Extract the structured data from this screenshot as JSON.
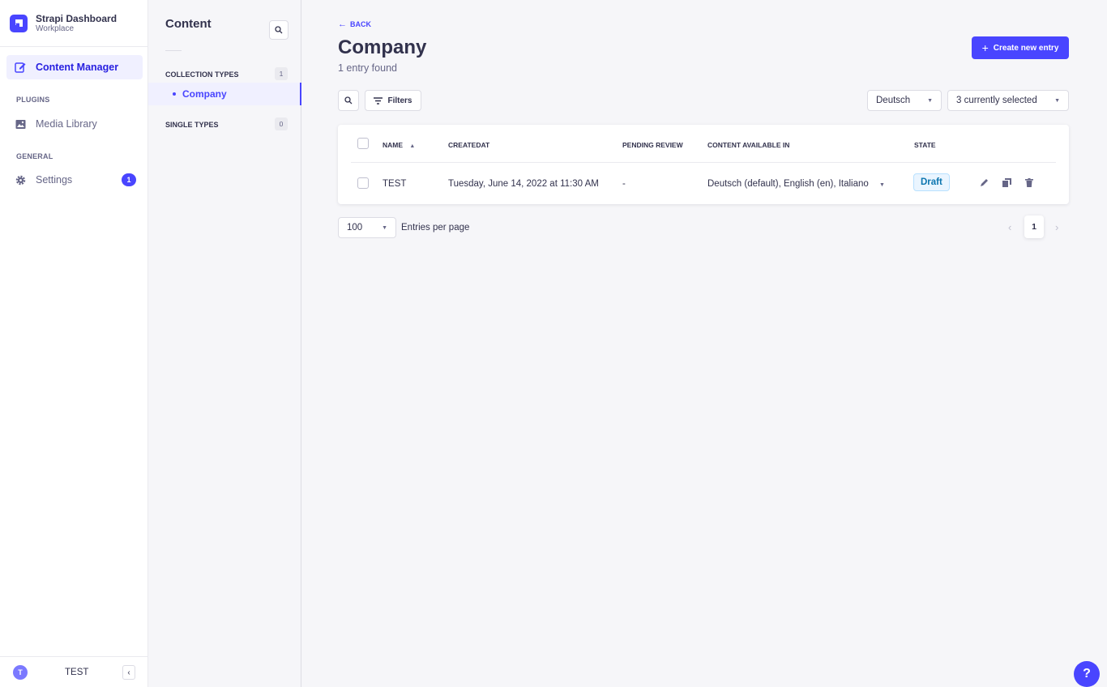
{
  "brand": {
    "title": "Strapi Dashboard",
    "subtitle": "Workplace"
  },
  "mainnav": {
    "content_manager": "Content Manager",
    "plugins_label": "PLUGINS",
    "media_library": "Media Library",
    "general_label": "GENERAL",
    "settings": "Settings",
    "settings_badge": "1"
  },
  "profile": {
    "initial": "T",
    "name": "TEST"
  },
  "subnav": {
    "title": "Content",
    "collection_types": "COLLECTION TYPES",
    "collection_count": "1",
    "company_link": "Company",
    "single_types": "SINGLE TYPES",
    "single_count": "0"
  },
  "header": {
    "back": "BACK",
    "title": "Company",
    "subtitle": "1 entry found",
    "create_button": "Create new entry"
  },
  "toolbar": {
    "filters": "Filters",
    "locale": "Deutsch",
    "columns": "3 currently selected"
  },
  "table": {
    "headers": {
      "name": "NAME",
      "createdat": "CREATEDAT",
      "pending_review": "PENDING REVIEW",
      "content_available_in": "CONTENT AVAILABLE IN",
      "state": "STATE"
    },
    "rows": [
      {
        "name": "TEST",
        "createdat": "Tuesday, June 14, 2022 at 11:30 AM",
        "pending_review": "-",
        "content_available_in": "Deutsch (default), English (en), Italiano",
        "state": "Draft"
      }
    ]
  },
  "pagination": {
    "per_page": "100",
    "per_page_label": "Entries per page",
    "current_page": "1"
  },
  "help": "?",
  "colors": {
    "primary": "#4945ff",
    "background": "#f6f6f9",
    "draft_text": "#0c75af"
  }
}
